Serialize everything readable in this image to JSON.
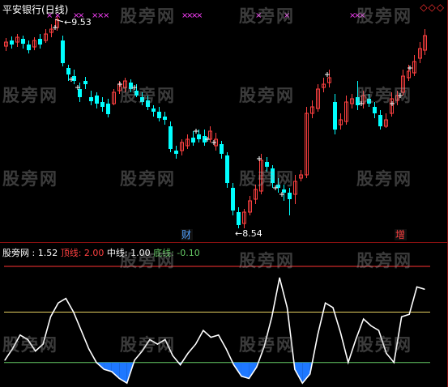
{
  "header": {
    "title": "平安银行(日线)",
    "diamonds": "◇◇◇"
  },
  "watermark": "股旁网",
  "colors": {
    "up": "#ff4040",
    "down": "#00ffff",
    "ma_line": "#ffffff",
    "grid_red": "#8a1010",
    "top_line": "#ff3333",
    "mid_line": "#e6d060",
    "bottom_line": "#66cc66",
    "fill": "#1e78ff",
    "marker_x": "#ff40ff"
  },
  "price_chart": {
    "high_label": "9.53",
    "low_label": "8.54",
    "tags": [
      "财",
      "增"
    ]
  },
  "indicator": {
    "name": "股旁网",
    "current_value_label": ": 1.52",
    "top_label": "顶线: 2.00",
    "mid_label": "中线: 1.00",
    "bottom_label": "底线: -0.10",
    "levels": {
      "top": 2.0,
      "mid": 1.0,
      "bottom": -0.1
    }
  },
  "chart_data": {
    "type": "line",
    "title": "",
    "series": [
      {
        "name": "股旁网",
        "values": [
          -0.05,
          0.2,
          0.5,
          0.4,
          0.15,
          0.3,
          0.9,
          1.2,
          1.3,
          1.0,
          0.6,
          0.2,
          -0.1,
          -0.25,
          -0.3,
          -0.45,
          -0.55,
          -0.05,
          0.15,
          0.4,
          0.3,
          0.4,
          0.05,
          -0.15,
          0.1,
          0.3,
          0.6,
          0.45,
          0.5,
          0.2,
          -0.15,
          -0.4,
          -0.45,
          -0.2,
          0.25,
          0.9,
          1.75,
          1.1,
          -0.25,
          -0.55,
          -0.35,
          0.5,
          1.2,
          1.1,
          0.55,
          -0.1,
          0.4,
          0.85,
          0.7,
          0.6,
          0.1,
          -0.1,
          0.9,
          0.95,
          1.55,
          1.5
        ]
      }
    ],
    "levels": {
      "top": 2.0,
      "mid": 1.0,
      "bottom": -0.1
    },
    "ylim": [
      -0.6,
      2.3
    ]
  }
}
